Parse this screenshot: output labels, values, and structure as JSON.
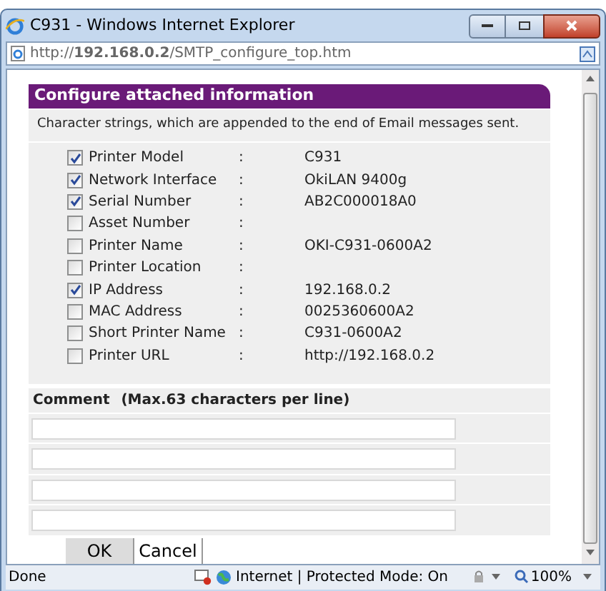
{
  "window": {
    "title": "C931 - Windows Internet Explorer"
  },
  "address_bar": {
    "url": "http://**192.168.0.2**/SMTP_configure_top.htm"
  },
  "section": {
    "title": "Configure attached information",
    "description": "Character strings, which are appended to the end of Email messages sent."
  },
  "items": [
    {
      "label": "Printer Model",
      "separator": ":",
      "value": "C931",
      "checked": true
    },
    {
      "label": "Network Interface",
      "separator": ":",
      "value": "OkiLAN 9400g",
      "checked": true
    },
    {
      "label": "Serial Number",
      "separator": ":",
      "value": "AB2C000018A0",
      "checked": true
    },
    {
      "label": "Asset Number",
      "separator": ":",
      "checked": false
    },
    {
      "label": "Printer Name",
      "separator": ":",
      "value": "OKI-C931-0600A2",
      "checked": false
    },
    {
      "label": "Printer Location",
      "separator": ":",
      "checked": false
    },
    {
      "label": "IP Address",
      "separator": ":",
      "value": "192.168.0.2",
      "checked": true
    },
    {
      "label": "MAC Address",
      "separator": ":",
      "value": "0025360600A2",
      "checked": false
    },
    {
      "label": "Short Printer Name",
      "separator": ":",
      "value": "C931-0600A2",
      "checked": false
    },
    {
      "label": "Printer URL",
      "separator": ":",
      "value": "http://192.168.0.2",
      "checked": false
    }
  ],
  "comment": {
    "title": "Comment",
    "hint": "(Max.63 characters per line)"
  },
  "buttons": [
    "OK",
    "Cancel"
  ],
  "status_bar": {
    "status": "Done",
    "zone": "Internet | Protected Mode: On",
    "zoom": "100%"
  }
}
